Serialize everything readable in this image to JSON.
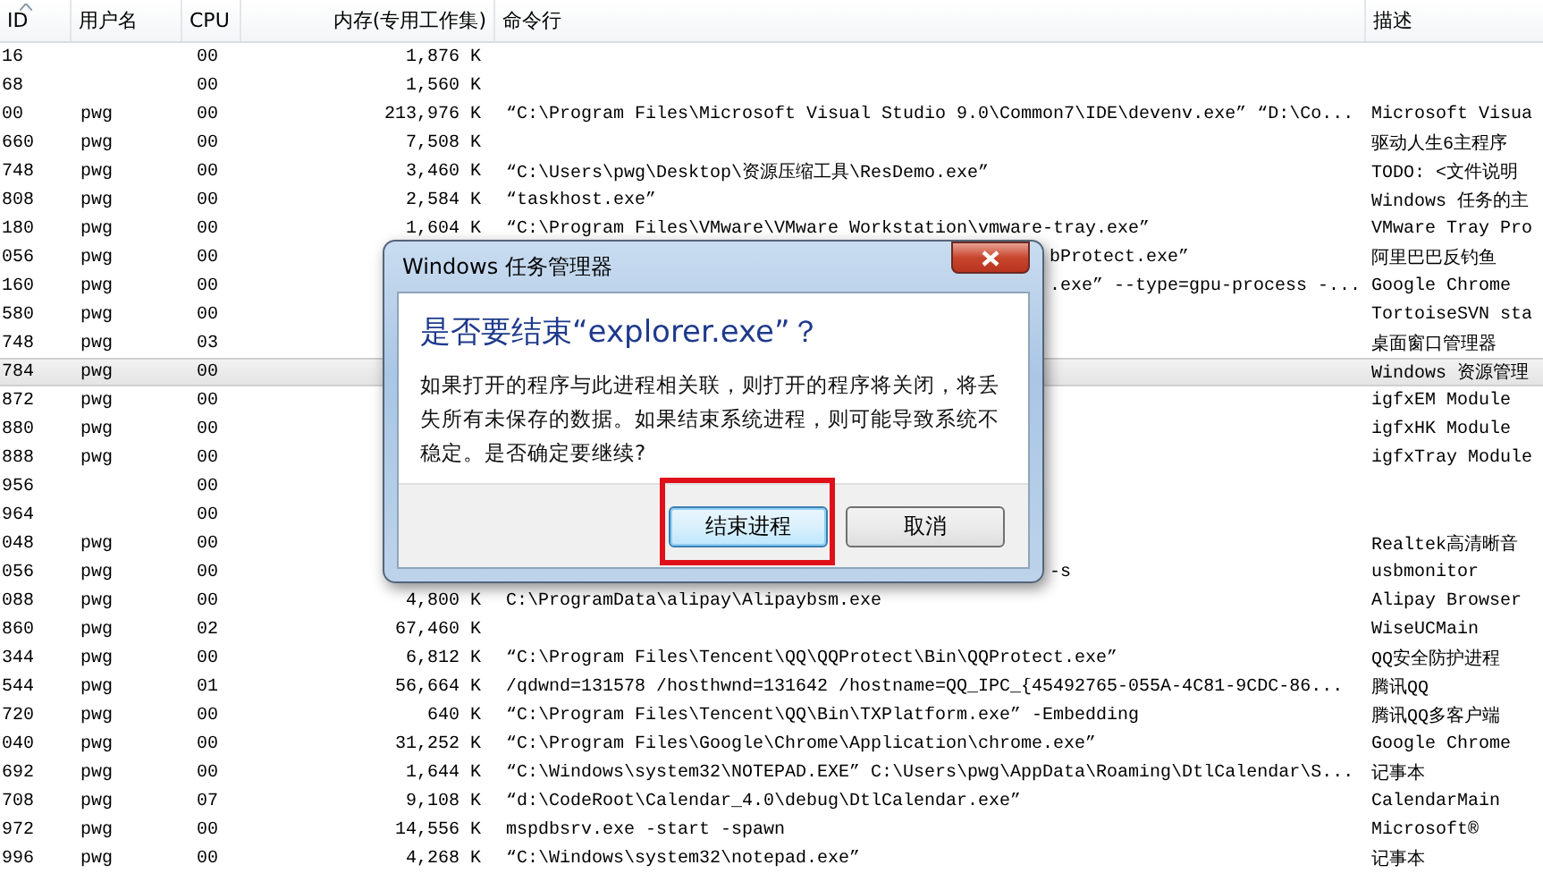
{
  "table": {
    "columns": [
      {
        "label": "ID",
        "sorted": true
      },
      {
        "label": "用户名",
        "sorted": false
      },
      {
        "label": "CPU",
        "sorted": false
      },
      {
        "label": "内存(专用工作集)",
        "sorted": false
      },
      {
        "label": "命令行",
        "sorted": false
      },
      {
        "label": "描述",
        "sorted": false
      }
    ],
    "rows": [
      {
        "id": "16",
        "cpu": "00",
        "memory": "1,876 K",
        "selected": false
      },
      {
        "id": "68",
        "cpu": "00",
        "memory": "1,560 K",
        "selected": false
      },
      {
        "id": "00",
        "user": "pwg",
        "cpu": "00",
        "memory": "213,976 K",
        "command": "“C:\\Program Files\\Microsoft Visual Studio 9.0\\Common7\\IDE\\devenv.exe” “D:\\Co...",
        "description": "Microsoft Visua",
        "selected": false
      },
      {
        "id": "660",
        "user": "pwg",
        "cpu": "00",
        "memory": "7,508 K",
        "description": "驱动人生6主程序",
        "selected": false
      },
      {
        "id": "748",
        "user": "pwg",
        "cpu": "00",
        "memory": "3,460 K",
        "command": "“C:\\Users\\pwg\\Desktop\\资源压缩工具\\ResDemo.exe”",
        "description": "TODO: <文件说明",
        "selected": false
      },
      {
        "id": "808",
        "user": "pwg",
        "cpu": "00",
        "memory": "2,584 K",
        "command": "“taskhost.exe”",
        "description": "Windows 任务的主",
        "selected": false
      },
      {
        "id": "180",
        "user": "pwg",
        "cpu": "00",
        "memory": "1,604 K",
        "command": "“C:\\Program Files\\VMware\\VMware Workstation\\vmware-tray.exe”",
        "description": "VMware Tray Pro",
        "selected": false
      },
      {
        "id": "056",
        "user": "pwg",
        "cpu": "00",
        "command": "bProtect.exe”",
        "command_covered": true,
        "description": "阿里巴巴反钓鱼",
        "selected": false
      },
      {
        "id": "160",
        "user": "pwg",
        "cpu": "00",
        "command": ".exe” --type=gpu-process -...",
        "command_covered": true,
        "description": "Google Chrome",
        "selected": false
      },
      {
        "id": "580",
        "user": "pwg",
        "cpu": "00",
        "description": "TortoiseSVN sta",
        "selected": false
      },
      {
        "id": "748",
        "user": "pwg",
        "cpu": "03",
        "description": "桌面窗口管理器",
        "selected": false
      },
      {
        "id": "784",
        "user": "pwg",
        "cpu": "00",
        "description": "Windows 资源管理",
        "selected": true
      },
      {
        "id": "872",
        "user": "pwg",
        "cpu": "00",
        "description": "igfxEM Module",
        "selected": false
      },
      {
        "id": "880",
        "user": "pwg",
        "cpu": "00",
        "description": "igfxHK Module",
        "selected": false
      },
      {
        "id": "888",
        "user": "pwg",
        "cpu": "00",
        "description": "igfxTray Module",
        "selected": false
      },
      {
        "id": "956",
        "cpu": "00",
        "selected": false
      },
      {
        "id": "964",
        "cpu": "00",
        "selected": false
      },
      {
        "id": "048",
        "user": "pwg",
        "cpu": "00",
        "description": "Realtek高清晰音",
        "selected": false
      },
      {
        "id": "056",
        "user": "pwg",
        "cpu": "00",
        "command": "-s",
        "command_covered": true,
        "description": "usbmonitor",
        "selected": false
      },
      {
        "id": "088",
        "user": "pwg",
        "cpu": "00",
        "memory": "4,800 K",
        "command": "C:\\ProgramData\\alipay\\Alipaybsm.exe",
        "description": "Alipay Browser",
        "selected": false
      },
      {
        "id": "860",
        "user": "pwg",
        "cpu": "02",
        "memory": "67,460 K",
        "description": "WiseUCMain",
        "selected": false
      },
      {
        "id": "344",
        "user": "pwg",
        "cpu": "00",
        "memory": "6,812 K",
        "command": "“C:\\Program Files\\Tencent\\QQ\\QQProtect\\Bin\\QQProtect.exe”",
        "description": "QQ安全防护进程",
        "selected": false
      },
      {
        "id": "544",
        "user": "pwg",
        "cpu": "01",
        "memory": "56,664 K",
        "command": "/qdwnd=131578  /hosthwnd=131642 /hostname=QQ_IPC_{45492765-055A-4C81-9CDC-86...",
        "description": "腾讯QQ",
        "selected": false
      },
      {
        "id": "720",
        "user": "pwg",
        "cpu": "00",
        "memory": "640 K",
        "command": "“C:\\Program Files\\Tencent\\QQ\\Bin\\TXPlatform.exe” -Embedding",
        "description": "腾讯QQ多客户端",
        "selected": false
      },
      {
        "id": "040",
        "user": "pwg",
        "cpu": "00",
        "memory": "31,252 K",
        "command": "“C:\\Program Files\\Google\\Chrome\\Application\\chrome.exe”",
        "description": "Google Chrome",
        "selected": false
      },
      {
        "id": "692",
        "user": "pwg",
        "cpu": "00",
        "memory": "1,644 K",
        "command": "“C:\\Windows\\system32\\NOTEPAD.EXE” C:\\Users\\pwg\\AppData\\Roaming\\DtlCalendar\\S...",
        "description": "记事本",
        "selected": false
      },
      {
        "id": "708",
        "user": "pwg",
        "cpu": "07",
        "memory": "9,108 K",
        "command": "“d:\\CodeRoot\\Calendar_4.0\\debug\\DtlCalendar.exe”",
        "description": "CalendarMain",
        "selected": false
      },
      {
        "id": "972",
        "user": "pwg",
        "cpu": "00",
        "memory": "14,556 K",
        "command": "mspdbsrv.exe -start -spawn",
        "description": "Microsoft®",
        "selected": false
      },
      {
        "id": "996",
        "user": "pwg",
        "cpu": "00",
        "memory": "4,268 K",
        "command": "“C:\\Windows\\system32\\notepad.exe”",
        "description": "记事本",
        "selected": false
      }
    ]
  },
  "dialog": {
    "title": "Windows 任务管理器",
    "heading": "是否要结束“explorer.exe”？",
    "message": "如果打开的程序与此进程相关联，则打开的程序将关闭，将丢失所有未保存的数据。如果结束系统进程，则可能导致系统不稳定。是否确定要继续?",
    "buttons": [
      {
        "label": "结束进程",
        "default": true,
        "highlighted": true
      },
      {
        "label": "取消",
        "default": false,
        "highlighted": false
      }
    ]
  }
}
